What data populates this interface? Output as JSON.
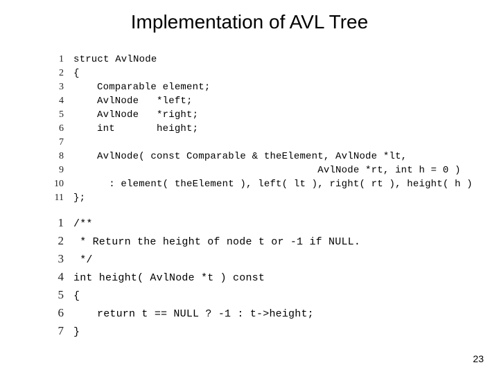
{
  "title": "Implementation of AVL Tree",
  "page_number": "23",
  "block1": {
    "lines": [
      {
        "n": "1",
        "indent": "",
        "text": "struct AvlNode"
      },
      {
        "n": "2",
        "indent": "",
        "text": "{"
      },
      {
        "n": "3",
        "indent": "ind1",
        "text": "Comparable element;"
      },
      {
        "n": "4",
        "indent": "ind1",
        "text": "AvlNode   *left;"
      },
      {
        "n": "5",
        "indent": "ind1",
        "text": "AvlNode   *right;"
      },
      {
        "n": "6",
        "indent": "ind1",
        "text": "int       height;"
      },
      {
        "n": "7",
        "indent": "",
        "text": ""
      },
      {
        "n": "8",
        "indent": "ind1",
        "text": "AvlNode( const Comparable & theElement, AvlNode *lt,"
      },
      {
        "n": "9",
        "indent": "ind1",
        "text": "                                     AvlNode *rt, int h = 0 )"
      },
      {
        "n": "10",
        "indent": "ind1",
        "text": "  : element( theElement ), left( lt ), right( rt ), height( h )"
      },
      {
        "n": "11",
        "indent": "",
        "text": "};"
      }
    ]
  },
  "block2": {
    "lines": [
      {
        "n": "1",
        "indent": "",
        "text": "/**"
      },
      {
        "n": "2",
        "indent": "",
        "text": " * Return the height of node t or -1 if NULL."
      },
      {
        "n": "3",
        "indent": "",
        "text": " */"
      },
      {
        "n": "4",
        "indent": "",
        "text": "int height( AvlNode *t ) const"
      },
      {
        "n": "5",
        "indent": "",
        "text": "{"
      },
      {
        "n": "6",
        "indent": "ind1",
        "text": "return t == NULL ? -1 : t->height;"
      },
      {
        "n": "7",
        "indent": "",
        "text": "}"
      }
    ]
  }
}
